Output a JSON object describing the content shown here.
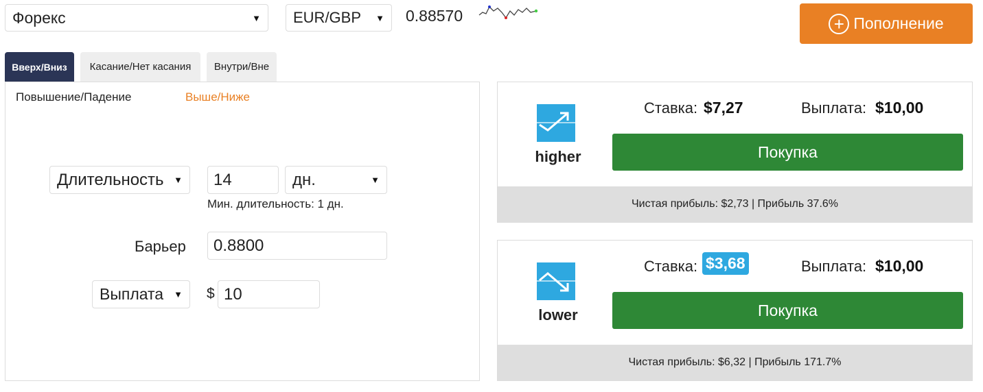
{
  "top_bar": {
    "market": "Форекс",
    "symbol": "EUR/GBP",
    "spot": "0.88570",
    "deposit_label": "Пополнение"
  },
  "tabs": [
    {
      "label": "Вверх/Вниз",
      "active": true
    },
    {
      "label": "Касание/Нет касания",
      "active": false
    },
    {
      "label": "Внутри/Вне",
      "active": false
    }
  ],
  "subtabs": [
    {
      "label": "Повышение/Падение",
      "active": false
    },
    {
      "label": "Выше/Ниже",
      "active": true
    }
  ],
  "form": {
    "duration_type": "Длительность",
    "duration_value": "14",
    "duration_unit": "дн.",
    "min_duration": "Мин. длительность: 1 дн.",
    "barrier_label": "Барьер",
    "barrier_value": "0.8800",
    "amount_type": "Выплата",
    "currency_sign": "$",
    "amount_value": "10"
  },
  "contracts": [
    {
      "type": "higher",
      "stake_label": "Ставка:",
      "stake_value": "$7,27",
      "payout_label": "Выплата:",
      "payout_value": "$10,00",
      "buy_label": "Покупка",
      "footer": "Чистая прибыль: $2,73 | Прибыль 37.6%"
    },
    {
      "type": "lower",
      "stake_label": "Ставка:",
      "stake_value": "$3,68",
      "payout_label": "Выплата:",
      "payout_value": "$10,00",
      "buy_label": "Покупка",
      "footer": "Чистая прибыль: $6,32 | Прибыль 171.7%"
    }
  ],
  "colors": {
    "accent_orange": "#e98024",
    "active_tab": "#2b3556",
    "buy_green": "#2e8836",
    "icon_blue": "#2ea8e0"
  },
  "icons": {
    "market_caret": "caret-down-icon",
    "deposit": "plus-circle-icon",
    "higher": "trend-up-icon",
    "lower": "trend-down-icon",
    "spot_sparkline": "sparkline-icon"
  }
}
